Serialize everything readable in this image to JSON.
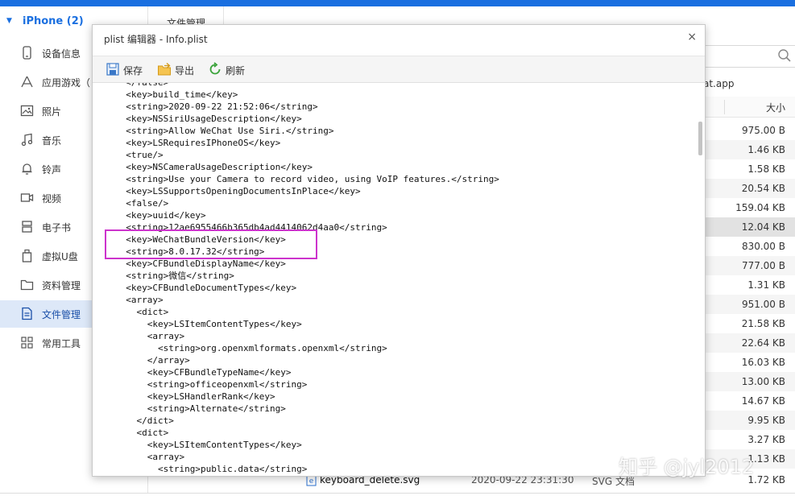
{
  "sidebar": {
    "device": "iPhone (2)",
    "items": [
      {
        "label": "设备信息",
        "icon": "phone-icon"
      },
      {
        "label": "应用游戏（",
        "icon": "apps-icon"
      },
      {
        "label": "照片",
        "icon": "image-icon"
      },
      {
        "label": "音乐",
        "icon": "music-icon"
      },
      {
        "label": "铃声",
        "icon": "bell-icon"
      },
      {
        "label": "视频",
        "icon": "video-icon"
      },
      {
        "label": "电子书",
        "icon": "book-icon"
      },
      {
        "label": "虚拟U盘",
        "icon": "usb-icon"
      },
      {
        "label": "资料管理",
        "icon": "folder-icon"
      },
      {
        "label": "文件管理",
        "icon": "file-icon"
      },
      {
        "label": "常用工具",
        "icon": "grid-icon"
      }
    ]
  },
  "background": {
    "tab": "文件管理",
    "path_suffix": "at.app",
    "size_header": "大小",
    "sizes": [
      "975.00 B",
      "1.46 KB",
      "1.58 KB",
      "20.54 KB",
      "159.04 KB",
      "12.04 KB",
      "830.00 B",
      "777.00 B",
      "1.31 KB",
      "951.00 B",
      "21.58 KB",
      "22.64 KB",
      "16.03 KB",
      "13.00 KB",
      "14.67 KB",
      "9.95 KB",
      "3.27 KB",
      "1.13 KB"
    ],
    "bottom_file": {
      "name": "keyboard_delete.svg",
      "date": "2020-09-22 23:31:30",
      "type": "SVG 文档",
      "size": "1.72 KB"
    }
  },
  "modal": {
    "title": "plist 编辑器 - Info.plist",
    "close": "×",
    "toolbar": {
      "save": "保存",
      "export": "导出",
      "refresh": "刷新"
    },
    "lines": [
      "  </false>",
      "  <key>build_time</key>",
      "  <string>2020-09-22 21:52:06</string>",
      "  <key>NSSiriUsageDescription</key>",
      "  <string>Allow WeChat Use Siri.</string>",
      "  <key>LSRequiresIPhoneOS</key>",
      "  <true/>",
      "  <key>NSCameraUsageDescription</key>",
      "  <string>Use your Camera to record video, using VoIP features.</string>",
      "  <key>LSSupportsOpeningDocumentsInPlace</key>",
      "  <false/>",
      "  <key>uuid</key>",
      "  <string>12ae6955466b365db4ad4414062d4aa0</string>",
      "  <key>WeChatBundleVersion</key>",
      "  <string>8.0.17.32</string>",
      "  <key>CFBundleDisplayName</key>",
      "  <string>微信</string>",
      "  <key>CFBundleDocumentTypes</key>",
      "  <array>",
      "    <dict>",
      "      <key>LSItemContentTypes</key>",
      "      <array>",
      "        <string>org.openxmlformats.openxml</string>",
      "      </array>",
      "      <key>CFBundleTypeName</key>",
      "      <string>officeopenxml</string>",
      "      <key>LSHandlerRank</key>",
      "      <string>Alternate</string>",
      "    </dict>",
      "    <dict>",
      "      <key>LSItemContentTypes</key>",
      "      <array>",
      "        <string>public.data</string>"
    ]
  },
  "watermark": "知乎 @jyl2012",
  "colors": {
    "accent": "#1a6fe0",
    "highlight": "#cc33cc",
    "active_bg": "#dde8f8"
  }
}
